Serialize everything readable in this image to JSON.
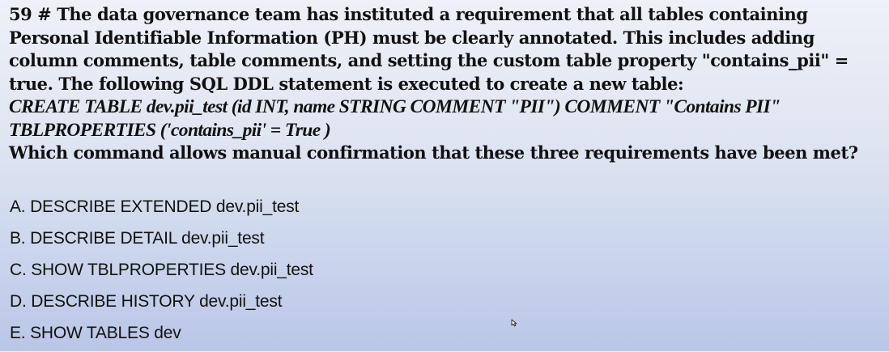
{
  "question": {
    "lines": [
      "59 # The data governance team has instituted a requirement that all tables containing",
      "Personal Identifiable Information (PH) must be clearly annotated. This includes adding",
      "column comments, table comments, and setting the custom table property \"contains_pii\" =",
      "true. The following SQL DDL statement is executed to create a new table:"
    ],
    "code_lines": [
      "CREATE TABLE dev.pii_test (id INT, name STRING COMMENT \"PII\") COMMENT \"Contains PII\"",
      "TBLPROPERTIES ('contains_pii' = True )"
    ],
    "prompt": "Which command allows manual confirmation that these three requirements have been met?"
  },
  "options": [
    {
      "label": "A. DESCRIBE EXTENDED dev.pii_test"
    },
    {
      "label": "B. DESCRIBE DETAIL dev.pii_test"
    },
    {
      "label": "C. SHOW TBLPROPERTIES dev.pii_test"
    },
    {
      "label": "D. DESCRIBE HISTORY dev.pii_test"
    },
    {
      "label": "E. SHOW TABLES dev"
    }
  ],
  "cursor": {
    "icon": "mouse-cursor-icon"
  }
}
